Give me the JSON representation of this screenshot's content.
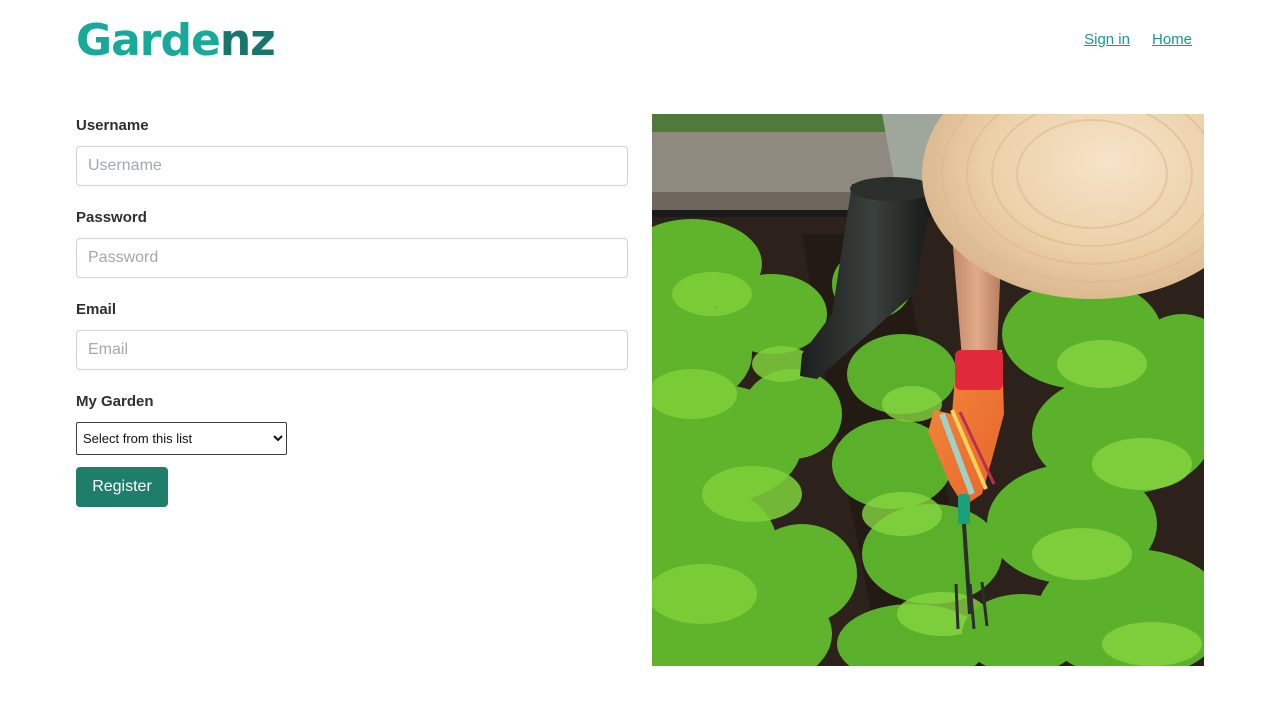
{
  "header": {
    "logo_part_a": "Garde",
    "logo_part_b": "nz",
    "nav": {
      "sign_in": "Sign in",
      "home": "Home"
    }
  },
  "form": {
    "username": {
      "label": "Username",
      "placeholder": "Username",
      "value": ""
    },
    "password": {
      "label": "Password",
      "placeholder": "Password",
      "value": ""
    },
    "email": {
      "label": "Email",
      "placeholder": "Email",
      "value": ""
    },
    "garden": {
      "label": "My Garden",
      "selected": "Select from this list"
    },
    "submit_label": "Register"
  },
  "colors": {
    "logo_primary": "#17a999",
    "logo_secondary": "#17766b",
    "link": "#179a8c",
    "button": "#1e7d6b"
  },
  "hero_image": {
    "subject": "gardener with straw hat, black rubber boot and striped glove weeding carrot rows"
  }
}
